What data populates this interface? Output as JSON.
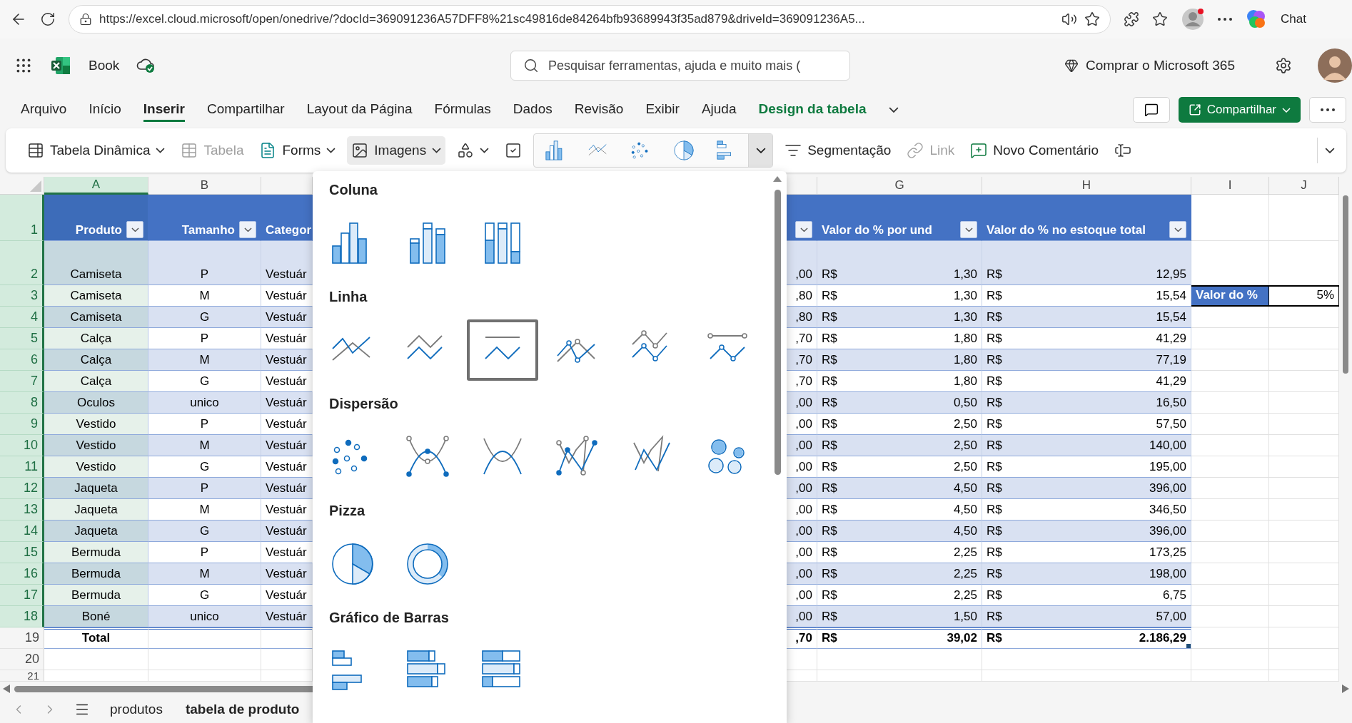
{
  "browser": {
    "url": "https://excel.cloud.microsoft/open/onedrive/?docId=369091236A57DFF8%21sc49816de84264bfb93689943f35ad879&driveId=369091236A5...",
    "chat_label": "Chat"
  },
  "app": {
    "title": "Book",
    "search": {
      "placeholder": "Pesquisar ferramentas, ajuda e muito mais ("
    },
    "buy_label": "Comprar o Microsoft 365"
  },
  "menu_tabs": [
    {
      "label": "Arquivo",
      "selected": false,
      "kind": "normal"
    },
    {
      "label": "Início",
      "selected": false,
      "kind": "normal"
    },
    {
      "label": "Inserir",
      "selected": true,
      "kind": "normal"
    },
    {
      "label": "Compartilhar",
      "selected": false,
      "kind": "normal"
    },
    {
      "label": "Layout da Página",
      "selected": false,
      "kind": "normal"
    },
    {
      "label": "Fórmulas",
      "selected": false,
      "kind": "normal"
    },
    {
      "label": "Dados",
      "selected": false,
      "kind": "normal"
    },
    {
      "label": "Revisão",
      "selected": false,
      "kind": "normal"
    },
    {
      "label": "Exibir",
      "selected": false,
      "kind": "normal"
    },
    {
      "label": "Ajuda",
      "selected": false,
      "kind": "normal"
    },
    {
      "label": "Design da tabela",
      "selected": false,
      "kind": "contextual"
    }
  ],
  "share_button": "Compartilhar",
  "ribbon": [
    {
      "kind": "command",
      "label": "Tabela Dinâmica",
      "caret": true,
      "disabled": false,
      "pressed": false
    },
    {
      "kind": "command",
      "label": "Tabela",
      "caret": false,
      "disabled": true,
      "pressed": false
    },
    {
      "kind": "command",
      "label": "Forms",
      "caret": true,
      "disabled": false,
      "pressed": false
    },
    {
      "kind": "command",
      "label": "Imagens",
      "caret": true,
      "disabled": false,
      "pressed": true
    },
    {
      "kind": "icon",
      "caret": true,
      "disabled": false,
      "pressed": false
    },
    {
      "kind": "icon",
      "caret": false,
      "disabled": false,
      "pressed": false
    },
    {
      "kind": "charts",
      "expanded": true
    },
    {
      "kind": "command",
      "label": "Segmentação",
      "caret": false,
      "disabled": false,
      "pressed": false
    },
    {
      "kind": "command",
      "label": "Link",
      "caret": false,
      "disabled": true,
      "pressed": false
    },
    {
      "kind": "command",
      "label": "Novo Comentário",
      "caret": false,
      "disabled": false,
      "pressed": false
    },
    {
      "kind": "icon",
      "caret": false,
      "disabled": false,
      "pressed": false
    }
  ],
  "sheet": {
    "column_headers": [
      {
        "label": "A",
        "selected": true
      },
      {
        "label": "B",
        "selected": false
      },
      {
        "selected": false
      },
      {
        "selected": false
      },
      {
        "label": "G",
        "selected": false
      },
      {
        "label": "H",
        "selected": false
      },
      {
        "label": "I",
        "selected": false
      },
      {
        "label": "J",
        "selected": false
      }
    ],
    "header_row": {
      "number": "1",
      "selected": true,
      "cells": [
        {
          "label": "Produto",
          "filter": true
        },
        {
          "label": "Tamanho",
          "filter": true
        },
        {
          "label": "Categor",
          "filter": false
        },
        {
          "filter": true
        },
        {
          "label": "Valor do % por und",
          "filter": true
        },
        {
          "label": "Valor do % no estoque total",
          "filter": true
        }
      ]
    },
    "rows": [
      {
        "number": "2",
        "selected": true,
        "product": "Camiseta",
        "size": "P",
        "category": "Vestuár",
        "f": ",00",
        "g_currency": "R$",
        "g": "1,30",
        "h_currency": "R$",
        "h": "12,95"
      },
      {
        "number": "3",
        "selected": true,
        "product": "Camiseta",
        "size": "M",
        "category": "Vestuár",
        "f": ",80",
        "g_currency": "R$",
        "g": "1,30",
        "h_currency": "R$",
        "h": "15,54",
        "i": "Valor do %",
        "j": "5%"
      },
      {
        "number": "4",
        "selected": true,
        "product": "Camiseta",
        "size": "G",
        "category": "Vestuár",
        "f": ",80",
        "g_currency": "R$",
        "g": "1,30",
        "h_currency": "R$",
        "h": "15,54"
      },
      {
        "number": "5",
        "selected": true,
        "product": "Calça",
        "size": "P",
        "category": "Vestuár",
        "f": ",70",
        "g_currency": "R$",
        "g": "1,80",
        "h_currency": "R$",
        "h": "41,29"
      },
      {
        "number": "6",
        "selected": true,
        "product": "Calça",
        "size": "M",
        "category": "Vestuár",
        "f": ",70",
        "g_currency": "R$",
        "g": "1,80",
        "h_currency": "R$",
        "h": "77,19"
      },
      {
        "number": "7",
        "selected": true,
        "product": "Calça",
        "size": "G",
        "category": "Vestuár",
        "f": ",70",
        "g_currency": "R$",
        "g": "1,80",
        "h_currency": "R$",
        "h": "41,29"
      },
      {
        "number": "8",
        "selected": true,
        "product": "Oculos",
        "size": "unico",
        "category": "Vestuár",
        "f": ",00",
        "g_currency": "R$",
        "g": "0,50",
        "h_currency": "R$",
        "h": "16,50"
      },
      {
        "number": "9",
        "selected": true,
        "product": "Vestido",
        "size": "P",
        "category": "Vestuár",
        "f": ",00",
        "g_currency": "R$",
        "g": "2,50",
        "h_currency": "R$",
        "h": "57,50"
      },
      {
        "number": "10",
        "selected": true,
        "product": "Vestido",
        "size": "M",
        "category": "Vestuár",
        "f": ",00",
        "g_currency": "R$",
        "g": "2,50",
        "h_currency": "R$",
        "h": "140,00"
      },
      {
        "number": "11",
        "selected": true,
        "product": "Vestido",
        "size": "G",
        "category": "Vestuár",
        "f": ",00",
        "g_currency": "R$",
        "g": "2,50",
        "h_currency": "R$",
        "h": "195,00"
      },
      {
        "number": "12",
        "selected": true,
        "product": "Jaqueta",
        "size": "P",
        "category": "Vestuár",
        "f": ",00",
        "g_currency": "R$",
        "g": "4,50",
        "h_currency": "R$",
        "h": "396,00"
      },
      {
        "number": "13",
        "selected": true,
        "product": "Jaqueta",
        "size": "M",
        "category": "Vestuár",
        "f": ",00",
        "g_currency": "R$",
        "g": "4,50",
        "h_currency": "R$",
        "h": "346,50"
      },
      {
        "number": "14",
        "selected": true,
        "product": "Jaqueta",
        "size": "G",
        "category": "Vestuár",
        "f": ",00",
        "g_currency": "R$",
        "g": "4,50",
        "h_currency": "R$",
        "h": "396,00"
      },
      {
        "number": "15",
        "selected": true,
        "product": "Bermuda",
        "size": "P",
        "category": "Vestuár",
        "f": ",00",
        "g_currency": "R$",
        "g": "2,25",
        "h_currency": "R$",
        "h": "173,25"
      },
      {
        "number": "16",
        "selected": true,
        "product": "Bermuda",
        "size": "M",
        "category": "Vestuár",
        "f": ",00",
        "g_currency": "R$",
        "g": "2,25",
        "h_currency": "R$",
        "h": "198,00"
      },
      {
        "number": "17",
        "selected": true,
        "product": "Bermuda",
        "size": "G",
        "category": "Vestuár",
        "f": ",00",
        "g_currency": "R$",
        "g": "2,25",
        "h_currency": "R$",
        "h": "6,75"
      },
      {
        "number": "18",
        "selected": true,
        "product": "Boné",
        "size": "unico",
        "category": "Vestuár",
        "f": ",00",
        "g_currency": "R$",
        "g": "1,50",
        "h_currency": "R$",
        "h": "57,00"
      }
    ],
    "total_row": {
      "number": "19",
      "selected": false,
      "label": "Total",
      "f": ",70",
      "g_currency": "R$",
      "g": "39,02",
      "h_currency": "R$",
      "h": "2.186,29"
    },
    "empty_rows": [
      {
        "number": "20",
        "selected": false
      },
      {
        "number": "21",
        "selected": false
      }
    ]
  },
  "sheet_tabs": [
    {
      "label": "produtos",
      "selected": false
    },
    {
      "label": "tabela de produto",
      "selected": true
    }
  ],
  "chart_menu": {
    "groups": [
      {
        "title": "Coluna",
        "kind": "column",
        "options": [
          {
            "kind": "clustered",
            "selected": false
          },
          {
            "kind": "stacked",
            "selected": false
          },
          {
            "kind": "percent",
            "selected": false
          }
        ]
      },
      {
        "title": "Linha",
        "kind": "line",
        "options": [
          {
            "kind": "line",
            "selected": false
          },
          {
            "kind": "stacked",
            "selected": false
          },
          {
            "kind": "percent",
            "selected": true
          },
          {
            "kind": "markers",
            "selected": false
          },
          {
            "kind": "stackedmarkers",
            "selected": false
          },
          {
            "kind": "percentmarkers",
            "selected": false
          }
        ]
      },
      {
        "title": "Dispersão",
        "kind": "scatter",
        "options": [
          {
            "kind": "markers",
            "selected": false
          },
          {
            "kind": "smoothmarkers",
            "selected": false
          },
          {
            "kind": "smooth",
            "selected": false
          },
          {
            "kind": "straightmarkers",
            "selected": false
          },
          {
            "kind": "straight",
            "selected": false
          },
          {
            "kind": "bubble",
            "selected": false
          }
        ]
      },
      {
        "title": "Pizza",
        "kind": "pie",
        "options": [
          {
            "kind": "pie",
            "selected": false
          },
          {
            "kind": "donut",
            "selected": false
          }
        ]
      },
      {
        "title": "Gráfico de Barras",
        "kind": "bar",
        "options": [
          {
            "kind": "clustered",
            "selected": false
          },
          {
            "kind": "stacked",
            "selected": false
          },
          {
            "kind": "percent",
            "selected": false
          }
        ]
      }
    ]
  }
}
